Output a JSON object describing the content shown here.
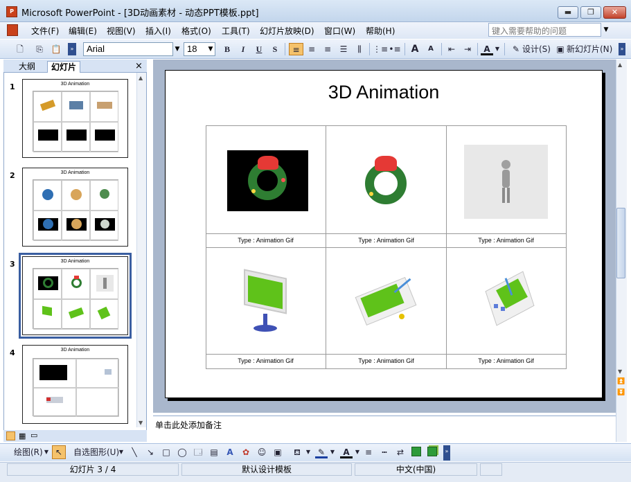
{
  "window": {
    "title": "Microsoft PowerPoint - [3D动画素材 - 动态PPT模板.ppt]",
    "min": "▬",
    "max": "❐",
    "close": "✕"
  },
  "menu": [
    "文件(F)",
    "编辑(E)",
    "视图(V)",
    "插入(I)",
    "格式(O)",
    "工具(T)",
    "幻灯片放映(D)",
    "窗口(W)",
    "帮助(H)"
  ],
  "help": {
    "placeholder": "键入需要帮助的问题"
  },
  "toolbar": {
    "font": "Arial",
    "size": "18",
    "bold": "B",
    "italic": "I",
    "underline": "U",
    "shadow": "S",
    "grow": "A",
    "shrink": "A",
    "font_color": "A",
    "design": "设计(S)",
    "new_slide": "新幻灯片(N)"
  },
  "panel": {
    "tab_outline": "大纲",
    "tab_slides": "幻灯片",
    "close": "×"
  },
  "thumbnails": [
    {
      "num": "1",
      "title": "3D Animation"
    },
    {
      "num": "2",
      "title": "3D Animation"
    },
    {
      "num": "3",
      "title": "3D Animation"
    },
    {
      "num": "4",
      "title": "3D Animation"
    }
  ],
  "slide": {
    "title": "3D Animation",
    "captions": [
      "Type : Animation Gif",
      "Type : Animation Gif",
      "Type : Animation Gif",
      "Type : Animation Gif",
      "Type : Animation Gif",
      "Type : Animation Gif"
    ]
  },
  "notes": "单击此处添加备注",
  "drawbar": {
    "draw": "绘图(R)",
    "autoshapes": "自选图形(U)"
  },
  "status": {
    "slide": "幻灯片 3 / 4",
    "template": "默认设计模板",
    "language": "中文(中国)"
  },
  "colors": {
    "accent": "#3a5ea1",
    "wreath": "#2e7d32",
    "bow": "#e53935",
    "screen": "#5fc21a"
  }
}
